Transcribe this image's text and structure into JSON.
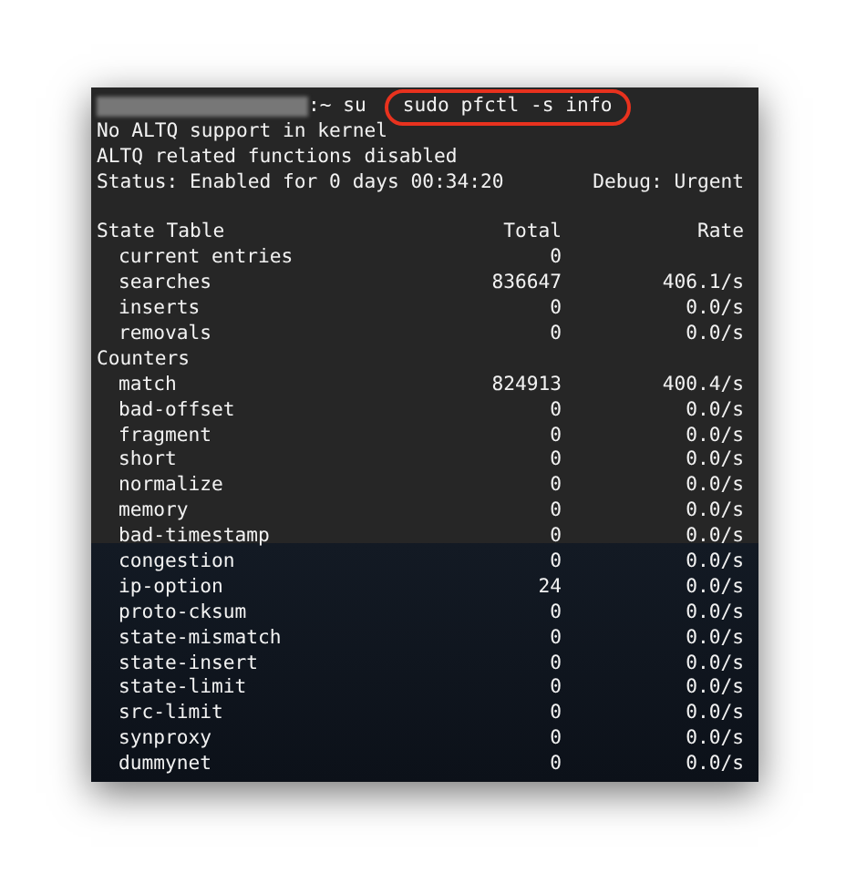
{
  "prompt": {
    "path": ":~ su",
    "command": "sudo pfctl -s info"
  },
  "messages": [
    "No ALTQ support in kernel",
    "ALTQ related functions disabled"
  ],
  "status": {
    "text": "Status: Enabled for 0 days 00:34:20",
    "debug": "Debug: Urgent"
  },
  "sections": [
    {
      "title": "State Table",
      "columns": [
        "Total",
        "Rate"
      ],
      "rows": [
        {
          "name": "current entries",
          "total": "0"
        },
        {
          "name": "searches",
          "total": "836647",
          "rate": "406.1/s"
        },
        {
          "name": "inserts",
          "total": "0",
          "rate": "0.0/s"
        },
        {
          "name": "removals",
          "total": "0",
          "rate": "0.0/s"
        }
      ]
    },
    {
      "title": "Counters",
      "rows": [
        {
          "name": "match",
          "total": "824913",
          "rate": "400.4/s"
        },
        {
          "name": "bad-offset",
          "total": "0",
          "rate": "0.0/s"
        },
        {
          "name": "fragment",
          "total": "0",
          "rate": "0.0/s"
        },
        {
          "name": "short",
          "total": "0",
          "rate": "0.0/s"
        },
        {
          "name": "normalize",
          "total": "0",
          "rate": "0.0/s"
        },
        {
          "name": "memory",
          "total": "0",
          "rate": "0.0/s"
        },
        {
          "name": "bad-timestamp",
          "total": "0",
          "rate": "0.0/s"
        },
        {
          "name": "congestion",
          "total": "0",
          "rate": "0.0/s"
        },
        {
          "name": "ip-option",
          "total": "24",
          "rate": "0.0/s"
        },
        {
          "name": "proto-cksum",
          "total": "0",
          "rate": "0.0/s"
        },
        {
          "name": "state-mismatch",
          "total": "0",
          "rate": "0.0/s"
        },
        {
          "name": "state-insert",
          "total": "0",
          "rate": "0.0/s"
        },
        {
          "name": "state-limit",
          "total": "0",
          "rate": "0.0/s"
        },
        {
          "name": "src-limit",
          "total": "0",
          "rate": "0.0/s"
        },
        {
          "name": "synproxy",
          "total": "0",
          "rate": "0.0/s"
        },
        {
          "name": "dummynet",
          "total": "0",
          "rate": "0.0/s"
        }
      ]
    }
  ]
}
